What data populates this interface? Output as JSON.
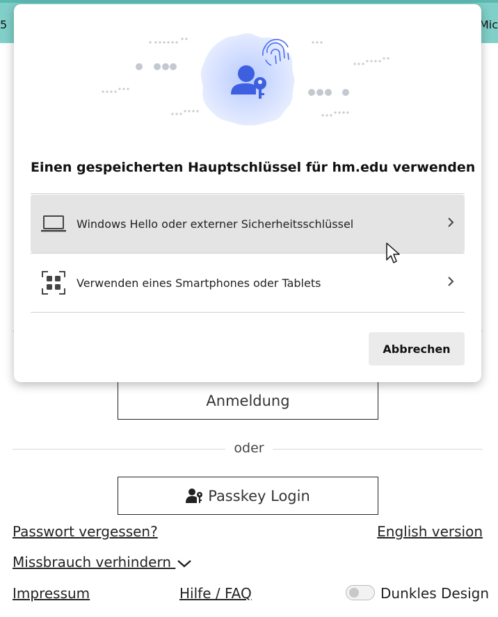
{
  "page": {
    "topbar_left": "5",
    "topbar_right": "Mic",
    "login_button": "Anmeldung",
    "or_separator": "oder",
    "passkey_button": "Passkey Login",
    "forgot_password": "Passwort vergessen?",
    "english_version": "English version",
    "abuse_prevention": "Missbrauch verhindern",
    "imprint": "Impressum",
    "help_faq": "Hilfe / FAQ",
    "dark_mode_label": "Dunkles Design",
    "dark_mode_on": false
  },
  "dialog": {
    "title": "Einen gespeicherten Hauptschlüssel für hm.edu verwenden",
    "options": [
      {
        "label": "Windows Hello oder externer Sicherheitsschlüssel",
        "icon": "laptop-icon",
        "hovered": true
      },
      {
        "label": "Verwenden eines Smartphones oder Tablets",
        "icon": "qr-code-icon",
        "hovered": false
      }
    ],
    "cancel_label": "Abbrechen"
  },
  "colors": {
    "topbar": "#80cfc9",
    "accent_blue": "#3d5fe0",
    "hover_bg": "#e4e4e4"
  }
}
